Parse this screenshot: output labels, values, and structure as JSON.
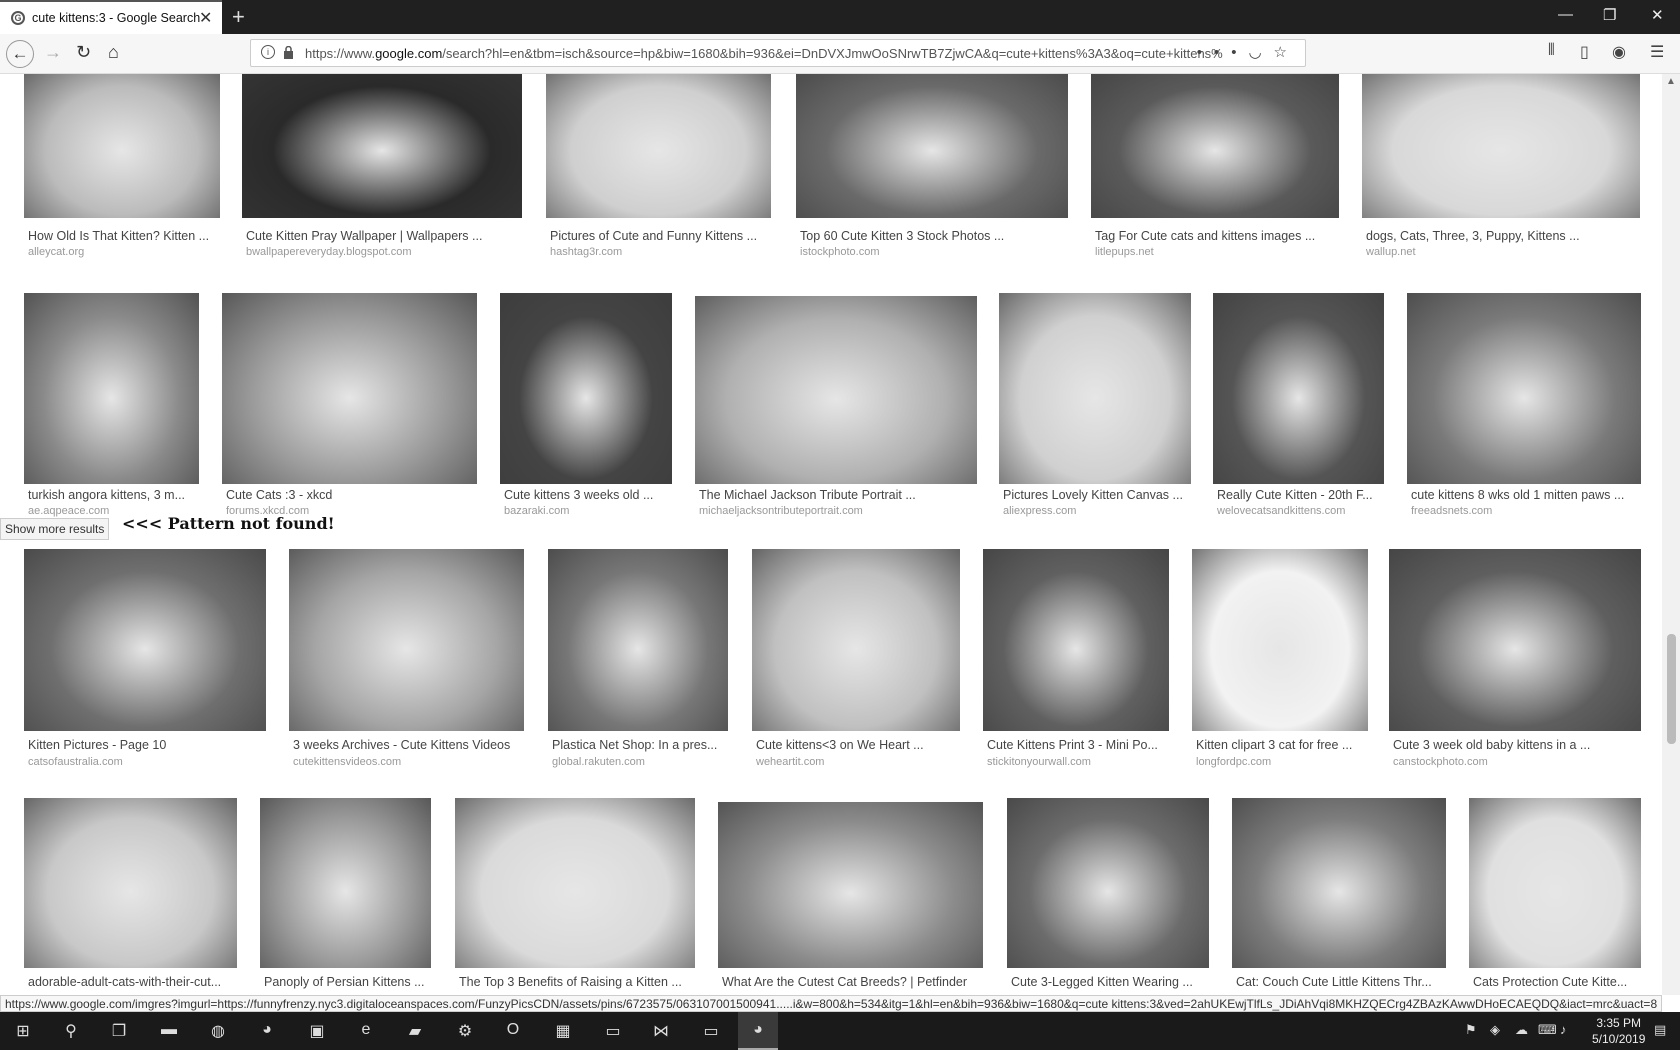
{
  "browser": {
    "tab_title": "cute kittens:3 - Google Search",
    "url_prefix": "https://www.",
    "url_host": "google.com",
    "url_rest": "/search?hl=en&tbm=isch&source=hp&biw=1680&bih=936&ei=DnDVXJmwOoSNrwTB7ZjwCA&q=cute+kittens%3A3&oq=cute+kittens%"
  },
  "results": [
    {
      "caption": "How Old Is That Kitten? Kitten ...",
      "domain": "alleycat.org",
      "shade": "#bbbbbb"
    },
    {
      "caption": "Cute Kitten Pray Wallpaper | Wallpapers ...",
      "domain": "bwallpapereveryday.blogspot.com",
      "shade": "#2a2a2a"
    },
    {
      "caption": "Pictures of Cute and Funny Kittens ...",
      "domain": "hashtag3r.com",
      "shade": "#cfcfcf"
    },
    {
      "caption": "Top 60 Cute Kitten 3 Stock Photos ...",
      "domain": "istockphoto.com",
      "shade": "#6a6a6a"
    },
    {
      "caption": "Tag For Cute cats and kittens images ...",
      "domain": "litlepups.net",
      "shade": "#5a5a5a"
    },
    {
      "caption": "dogs, Cats, Three, 3, Puppy, Kittens ...",
      "domain": "wallup.net",
      "shade": "#d8d8d8"
    },
    {
      "caption": "turkish angora kittens, 3 m...",
      "domain": "ae.aqpeace.com",
      "shade": "#8a8a8a"
    },
    {
      "caption": "Cute Cats :3 - xkcd",
      "domain": "forums.xkcd.com",
      "shade": "#999999"
    },
    {
      "caption": "Cute kittens 3 weeks old ...",
      "domain": "bazaraki.com",
      "shade": "#444444"
    },
    {
      "caption": "The Michael Jackson Tribute Portrait ...",
      "domain": "michaeljacksontributeportrait.com",
      "shade": "#b0b0b0"
    },
    {
      "caption": "Pictures Lovely Kitten Canvas ...",
      "domain": "aliexpress.com",
      "shade": "#d0d0d0"
    },
    {
      "caption": "Really Cute Kitten - 20th F...",
      "domain": "welovecatsandkittens.com",
      "shade": "#555555"
    },
    {
      "caption": "cute kittens 8 wks old 1 mitten paws ...",
      "domain": "freeadsnets.com",
      "shade": "#7a7a7a"
    },
    {
      "caption": "Kitten Pictures - Page 10",
      "domain": "catsofaustralia.com",
      "shade": "#6f6f6f"
    },
    {
      "caption": "3 weeks Archives - Cute Kittens Videos",
      "domain": "cutekittensvideos.com",
      "shade": "#a5a5a5"
    },
    {
      "caption": "Plastica Net Shop: In a pres...",
      "domain": "global.rakuten.com",
      "shade": "#777777"
    },
    {
      "caption": "Cute kittens<3 on We Heart ...",
      "domain": "weheartit.com",
      "shade": "#c0c0c0"
    },
    {
      "caption": "Cute Kittens Print 3 - Mini Po...",
      "domain": "stickitonyourwall.com",
      "shade": "#606060"
    },
    {
      "caption": "Kitten clipart 3 cat for free ...",
      "domain": "longfordpc.com",
      "shade": "#f2f2f2"
    },
    {
      "caption": "Cute 3 week old baby kittens in a ...",
      "domain": "canstockphoto.com",
      "shade": "#5f5f5f"
    },
    {
      "caption": "adorable-adult-cats-with-their-cut...",
      "domain": "",
      "shade": "#c8c8c8"
    },
    {
      "caption": "Panoply of Persian Kittens ...",
      "domain": "",
      "shade": "#9a9a9a"
    },
    {
      "caption": "The Top 3 Benefits of Raising a Kitten ...",
      "domain": "",
      "shade": "#dadada"
    },
    {
      "caption": "What Are the Cutest Cat Breeds? | Petfinder",
      "domain": "",
      "shade": "#8c8c8c"
    },
    {
      "caption": "Cute 3-Legged Kitten Wearing ...",
      "domain": "",
      "shade": "#6c6c6c"
    },
    {
      "caption": "Cat: Couch Cute Little Kittens Thr...",
      "domain": "",
      "shade": "#7d7d7d"
    },
    {
      "caption": "Cats Protection Cute Kitte...",
      "domain": "",
      "shade": "#e0e0e0"
    }
  ],
  "overlay": {
    "show_more": "Show more results",
    "pattern": "<<< Pattern not found!"
  },
  "status_url": "https://www.google.com/imgres?imgurl=https://funnyfrenzy.nyc3.digitaloceanspaces.com/FunzyPicsCDN/assets/pins/6723575/063107001500941.....i&w=800&h=534&itg=1&hl=en&bih=936&biw=1680&q=cute kittens:3&ved=2ahUKEwjTlfLs_JDiAhVqi8MKHZQECrg4ZBAzKAwwDHoECAEQDQ&iact=mrc&uact=8",
  "clock": {
    "time": "3:35 PM",
    "date": "5/10/2019"
  }
}
